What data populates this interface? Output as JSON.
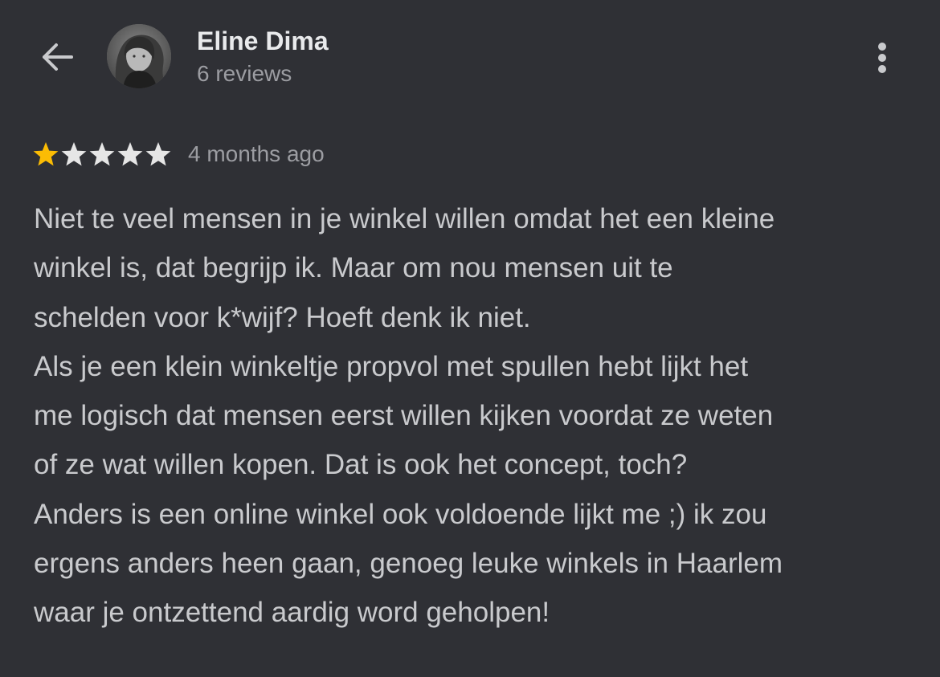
{
  "header": {
    "back_icon": "arrow-left-icon",
    "avatar_icon": "user-photo-avatar",
    "user_name": "Eline Dima",
    "review_count": "6 reviews",
    "more_icon": "more-vertical-icon"
  },
  "rating": {
    "stars_filled": 1,
    "stars_total": 5,
    "time_ago": "4 months ago",
    "filled_color": "#fbbc04",
    "empty_color": "#e6e6e6"
  },
  "review": {
    "lines": [
      "Niet te veel mensen in je winkel willen omdat het een kleine",
      "winkel is, dat begrijp ik. Maar om nou mensen uit te",
      "schelden voor k*wijf? Hoeft denk ik niet.",
      "Als je een klein winkeltje propvol met spullen hebt lijkt het",
      "me logisch dat mensen eerst willen kijken voordat ze weten",
      "of ze wat willen kopen. Dat is ook het concept, toch?",
      "Anders is een online winkel ook voldoende lijkt me ;) ik zou",
      "ergens anders heen gaan, genoeg leuke winkels in Haarlem",
      "waar je ontzettend aardig word geholpen!"
    ]
  },
  "colors": {
    "background": "#2f3035",
    "primary_text": "#e9eaec",
    "secondary_text": "#9c9da2",
    "body_text": "#c9cacd"
  }
}
